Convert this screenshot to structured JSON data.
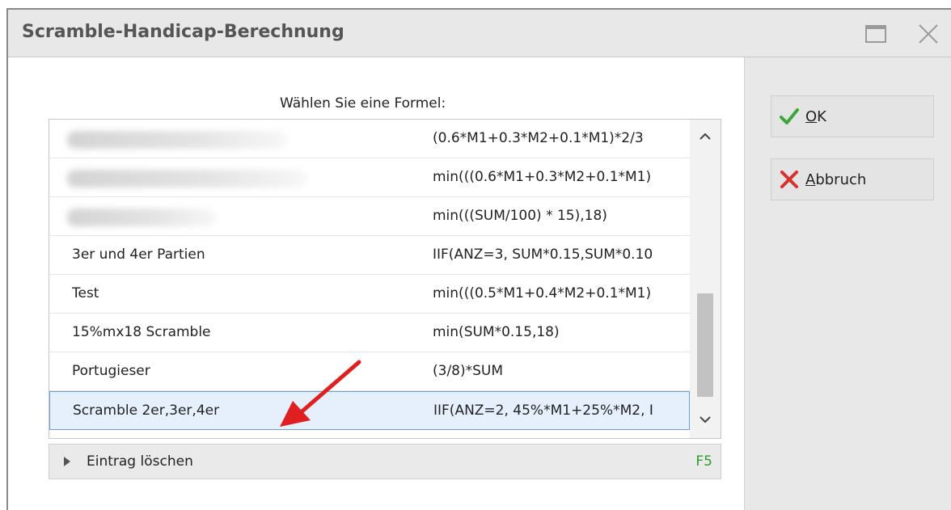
{
  "window": {
    "title": "Scramble-Handicap-Berechnung"
  },
  "main": {
    "prompt": "Wählen Sie eine Formel:",
    "rows": [
      {
        "name": "",
        "formula": "(0.6*M1+0.3*M2+0.1*M1)*2/3",
        "blurred": true
      },
      {
        "name": "",
        "formula": "min(((0.6*M1+0.3*M2+0.1*M1)",
        "blurred": true
      },
      {
        "name": "",
        "formula": "min(((SUM/100) * 15),18)",
        "blurred": true
      },
      {
        "name": "3er und 4er Partien",
        "formula": "IIF(ANZ=3, SUM*0.15,SUM*0.10"
      },
      {
        "name": "Test",
        "formula": "min(((0.5*M1+0.4*M2+0.1*M1)"
      },
      {
        "name": "15%mx18 Scramble",
        "formula": "min(SUM*0.15,18)"
      },
      {
        "name": "Portugieser",
        "formula": "(3/8)*SUM"
      },
      {
        "name": "Scramble 2er,3er,4er",
        "formula": "IIF(ANZ=2, 45%*M1+25%*M2, I",
        "selected": true
      }
    ],
    "delete_expander": {
      "label": "Eintrag löschen",
      "shortcut": "F5"
    }
  },
  "sidebar": {
    "ok_label_accel": "O",
    "ok_label_rest": "K",
    "cancel_label_accel": "A",
    "cancel_label_rest": "bbruch"
  },
  "colors": {
    "accent_ok": "#3aa63a",
    "accent_cancel": "#d9302b",
    "selection_border": "#6aa2dd",
    "annotation_arrow": "#e02020"
  }
}
